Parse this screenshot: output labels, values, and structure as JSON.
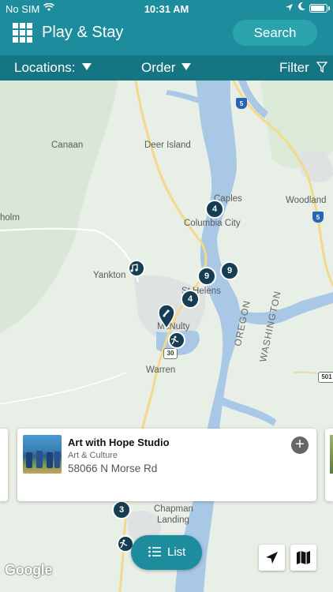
{
  "status": {
    "carrier": "No SIM",
    "time": "10:31 AM"
  },
  "header": {
    "title": "Play & Stay",
    "search_label": "Search"
  },
  "filterbar": {
    "locations_label": "Locations:",
    "order_label": "Order",
    "filter_label": "Filter"
  },
  "map": {
    "places": [
      "Canaan",
      "Deer Island",
      "Caples",
      "Woodland",
      "Columbia City",
      "holm",
      "Yankton",
      "St Helens",
      "McNulty",
      "Warren",
      "OREGON",
      "WASHINGTON",
      "Chapman",
      "Landing"
    ],
    "shields": [
      "5",
      "5",
      "30",
      "501"
    ],
    "clusters": [
      "4",
      "9",
      "9",
      "4",
      "3"
    ],
    "attribution": "Google"
  },
  "card": {
    "title": "Art with Hope Studio",
    "category": "Art & Culture",
    "address": "58066 N Morse Rd"
  },
  "list_button": {
    "label": "List"
  },
  "colors": {
    "header": "#1d8c9c",
    "filterbar": "#157583",
    "marker": "#163d52",
    "water": "#a8c8e6"
  }
}
